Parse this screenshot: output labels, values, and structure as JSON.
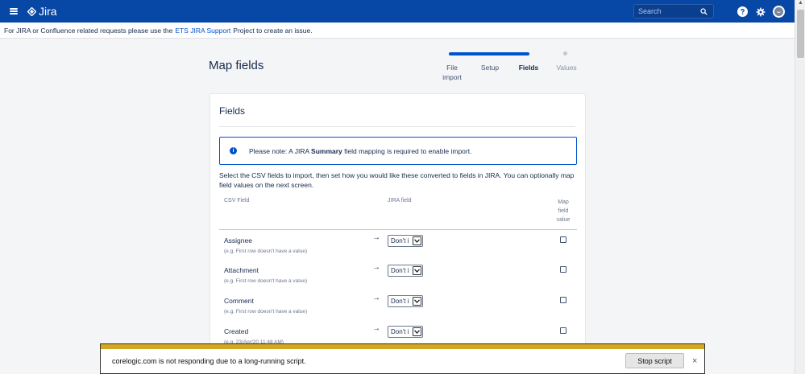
{
  "app": {
    "name": "Jira"
  },
  "search": {
    "placeholder": "Search"
  },
  "banner": {
    "prefix": "For JIRA or Confluence related requests please use the",
    "link": "ETS JIRA Support",
    "suffix": "Project to create an issue."
  },
  "page": {
    "title": "Map fields"
  },
  "steps": [
    {
      "line1": "File",
      "line2": "import"
    },
    {
      "line1": "Setup"
    },
    {
      "line1": "Fields"
    },
    {
      "line1": "Values"
    }
  ],
  "card": {
    "title": "Fields",
    "note_prefix": "Please note: A JIRA",
    "note_bold": "Summary",
    "note_suffix": "field mapping is required to enable import.",
    "description": "Select the CSV fields to import, then set how you would like these converted to fields in JIRA. You can optionally map field values on the next screen."
  },
  "table": {
    "col_csv": "CSV Field",
    "col_jira": "JIRA field",
    "col_map_1": "Map",
    "col_map_2": "field",
    "col_map_3": "value",
    "arrow": "→",
    "rows": [
      {
        "field": "Assignee",
        "hint": "(e.g. First row doesn't have a value)",
        "select": "Don't i"
      },
      {
        "field": "Attachment",
        "hint": "(e.g. First row doesn't have a value)",
        "select": "Don't i"
      },
      {
        "field": "Comment",
        "hint": "(e.g. First row doesn't have a value)",
        "select": "Don't i"
      },
      {
        "field": "Created",
        "hint": "(e.g. 23/Apr/20 11:48 AM)",
        "select": "Don't i"
      }
    ]
  },
  "dialog": {
    "message": "corelogic.com is not responding due to a long-running script.",
    "stop_label": "Stop script",
    "close_glyph": "×"
  },
  "colors": {
    "topbar": "#0747a6",
    "accent": "#0052cc",
    "dialog_stripe": "#d4a723"
  }
}
